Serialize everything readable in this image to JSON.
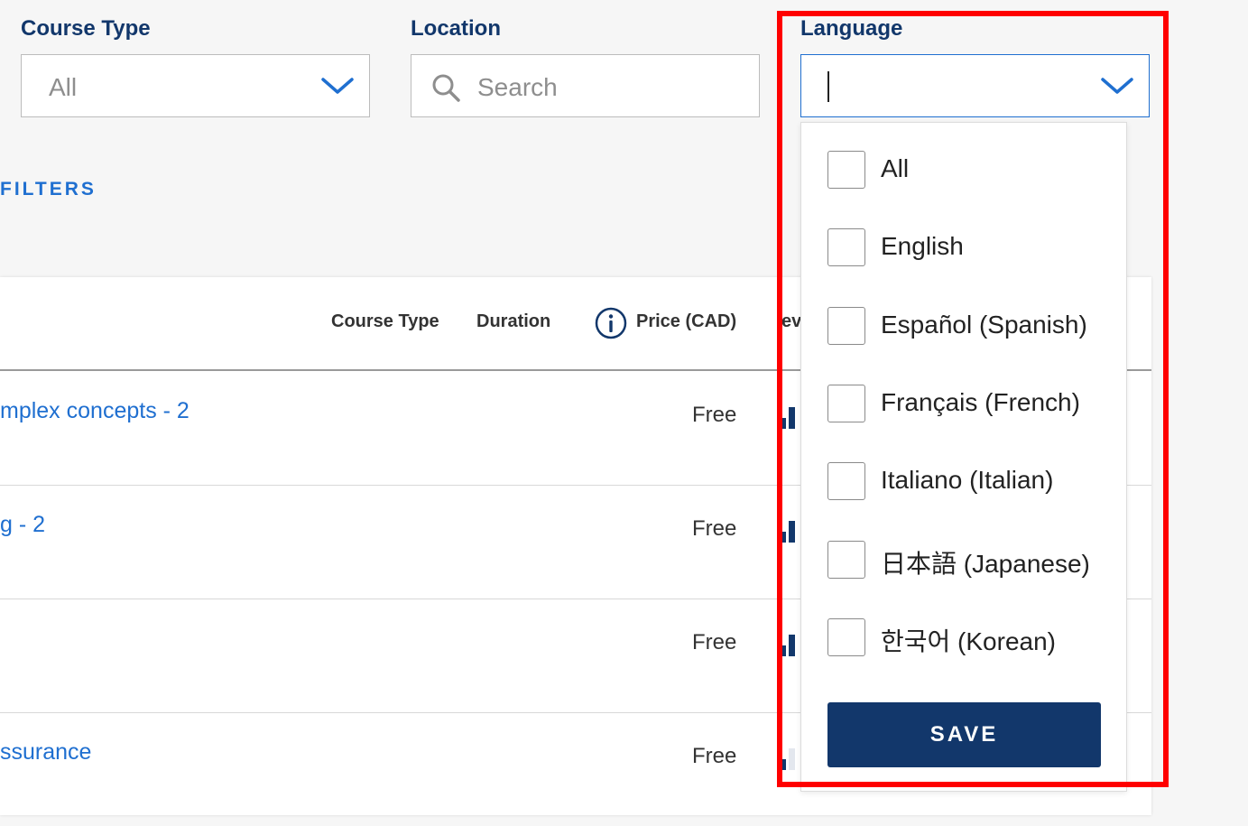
{
  "filters": {
    "course_type": {
      "label": "Course Type",
      "value": "All"
    },
    "location": {
      "label": "Location",
      "placeholder": "Search"
    },
    "language": {
      "label": "Language",
      "value": ""
    },
    "more_filters": "FILTERS"
  },
  "table": {
    "headers": {
      "course_type": "Course Type",
      "duration": "Duration",
      "price": "Price (CAD)",
      "partial_next": "ev"
    },
    "rows": [
      {
        "title": "mplex concepts - 2",
        "price": "Free"
      },
      {
        "title": "g - 2",
        "price": "Free"
      },
      {
        "title": "",
        "price": "Free"
      },
      {
        "title": "ssurance",
        "price": "Free"
      }
    ]
  },
  "language_dropdown": {
    "options": [
      {
        "label": "All",
        "checked": false
      },
      {
        "label": "English",
        "checked": false
      },
      {
        "label": "Español (Spanish)",
        "checked": false
      },
      {
        "label": "Français (French)",
        "checked": false
      },
      {
        "label": "Italiano (Italian)",
        "checked": false
      },
      {
        "label": "日本語 (Japanese)",
        "checked": false
      },
      {
        "label": "한국어 (Korean)",
        "checked": false
      }
    ],
    "save_label": "SAVE"
  },
  "icons": {
    "course_type_chevron": "chevron-down-icon",
    "location_search": "search-icon",
    "language_chevron": "chevron-down-icon",
    "price_info": "info-icon"
  },
  "colors": {
    "navy": "#12376b",
    "link_blue": "#1f6fd0",
    "highlight": "#ff0000"
  }
}
